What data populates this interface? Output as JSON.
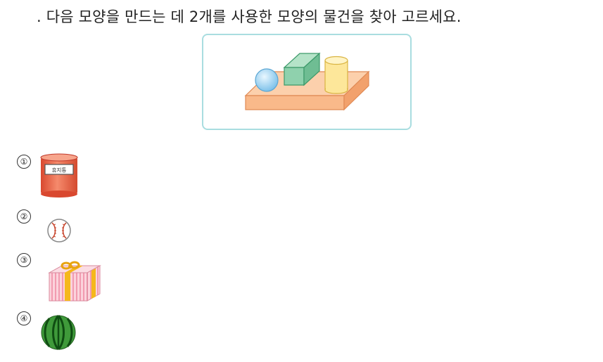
{
  "question": {
    "text": ". 다음 모양을 만드는 데 2개를 사용한 모양의 물건을 찾아 고르세요."
  },
  "options": [
    {
      "number": "1",
      "label": "휴지통",
      "icon": "trash-can-cylinder"
    },
    {
      "number": "2",
      "icon": "baseball-sphere"
    },
    {
      "number": "3",
      "icon": "gift-box-cuboid"
    },
    {
      "number": "4",
      "icon": "watermelon-sphere"
    }
  ],
  "colors": {
    "box_border": "#a9dde0",
    "base_plate": "#f9b98a",
    "cube": "#8fd1ad",
    "cylinder": "#fde79a",
    "sphere": "#a9d8f3"
  }
}
